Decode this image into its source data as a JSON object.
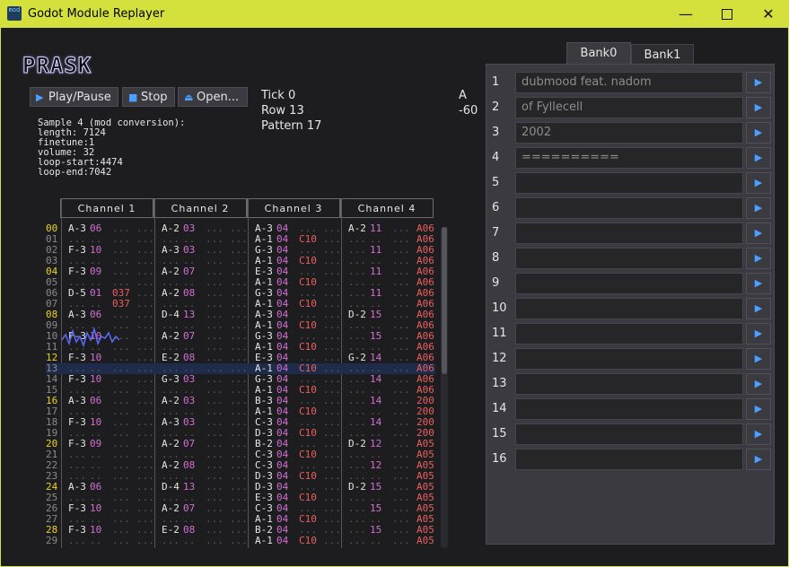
{
  "window": {
    "title": "Godot Module Replayer",
    "icon_label": "mod"
  },
  "logo": "PRASK",
  "buttons": {
    "play": "Play/Pause",
    "stop": "Stop",
    "open": "Open..."
  },
  "status": {
    "tick": "Tick 0",
    "row": "Row 13",
    "pattern": "Pattern 17",
    "right_top": "A",
    "right_bottom": "-60"
  },
  "sample_info": [
    "Sample 4 (mod conversion):",
    "length: 7124",
    "finetune:1",
    "volume: 32",
    "loop-start:4474",
    "loop-end:7042"
  ],
  "channels": [
    "Channel 1",
    "Channel 2",
    "Channel 3",
    "Channel 4"
  ],
  "current_row": 13,
  "rows": [
    {
      "n": "00",
      "c": [
        [
          "A-3",
          "06",
          "",
          ""
        ],
        [
          "A-2",
          "03",
          "",
          ""
        ],
        [
          "A-3",
          "04",
          "",
          ""
        ],
        [
          "A-2",
          "11",
          "",
          "A06"
        ]
      ]
    },
    {
      "n": "01",
      "c": [
        [
          "",
          "",
          "",
          ""
        ],
        [
          "",
          "",
          "",
          ""
        ],
        [
          "A-1",
          "04",
          "C10",
          ""
        ],
        [
          "",
          "",
          "",
          "A06"
        ]
      ]
    },
    {
      "n": "02",
      "c": [
        [
          "F-3",
          "10",
          "",
          ""
        ],
        [
          "A-3",
          "03",
          "",
          ""
        ],
        [
          "G-3",
          "04",
          "",
          ""
        ],
        [
          "",
          "11",
          "",
          "A06"
        ]
      ]
    },
    {
      "n": "03",
      "c": [
        [
          "",
          "",
          "",
          ""
        ],
        [
          "",
          "",
          "",
          ""
        ],
        [
          "A-1",
          "04",
          "C10",
          ""
        ],
        [
          "",
          "",
          "",
          "A06"
        ]
      ]
    },
    {
      "n": "04",
      "c": [
        [
          "F-3",
          "09",
          "",
          ""
        ],
        [
          "A-2",
          "07",
          "",
          ""
        ],
        [
          "E-3",
          "04",
          "",
          ""
        ],
        [
          "",
          "11",
          "",
          "A06"
        ]
      ]
    },
    {
      "n": "05",
      "c": [
        [
          "",
          "",
          "",
          ""
        ],
        [
          "",
          "",
          "",
          ""
        ],
        [
          "A-1",
          "04",
          "C10",
          ""
        ],
        [
          "",
          "",
          "",
          "A06"
        ]
      ]
    },
    {
      "n": "06",
      "c": [
        [
          "D-5",
          "01",
          "037",
          ""
        ],
        [
          "A-2",
          "08",
          "",
          ""
        ],
        [
          "G-3",
          "04",
          "",
          ""
        ],
        [
          "",
          "11",
          "",
          "A06"
        ]
      ]
    },
    {
      "n": "07",
      "c": [
        [
          "",
          "",
          "037",
          ""
        ],
        [
          "",
          "",
          "",
          ""
        ],
        [
          "A-1",
          "04",
          "C10",
          ""
        ],
        [
          "",
          "",
          "",
          "A06"
        ]
      ]
    },
    {
      "n": "08",
      "c": [
        [
          "A-3",
          "06",
          "",
          ""
        ],
        [
          "D-4",
          "13",
          "",
          ""
        ],
        [
          "A-3",
          "04",
          "",
          ""
        ],
        [
          "D-2",
          "15",
          "",
          "A06"
        ]
      ]
    },
    {
      "n": "09",
      "c": [
        [
          "",
          "",
          "",
          ""
        ],
        [
          "",
          "",
          "",
          ""
        ],
        [
          "A-1",
          "04",
          "C10",
          ""
        ],
        [
          "",
          "",
          "",
          "A06"
        ]
      ]
    },
    {
      "n": "10",
      "c": [
        [
          "F-3",
          "10",
          "",
          ""
        ],
        [
          "A-2",
          "07",
          "",
          ""
        ],
        [
          "G-3",
          "04",
          "",
          ""
        ],
        [
          "",
          "15",
          "",
          "A06"
        ]
      ]
    },
    {
      "n": "11",
      "c": [
        [
          "",
          "",
          "",
          ""
        ],
        [
          "",
          "",
          "",
          ""
        ],
        [
          "A-1",
          "04",
          "C10",
          ""
        ],
        [
          "",
          "",
          "",
          "A06"
        ]
      ]
    },
    {
      "n": "12",
      "c": [
        [
          "F-3",
          "10",
          "",
          ""
        ],
        [
          "E-2",
          "08",
          "",
          ""
        ],
        [
          "E-3",
          "04",
          "",
          ""
        ],
        [
          "G-2",
          "14",
          "",
          "A06"
        ]
      ]
    },
    {
      "n": "13",
      "c": [
        [
          "",
          "",
          "",
          ""
        ],
        [
          "",
          "",
          "",
          ""
        ],
        [
          "A-1",
          "04",
          "C10",
          ""
        ],
        [
          "",
          "",
          "",
          "A06"
        ]
      ]
    },
    {
      "n": "14",
      "c": [
        [
          "F-3",
          "10",
          "",
          ""
        ],
        [
          "G-3",
          "03",
          "",
          ""
        ],
        [
          "G-3",
          "04",
          "",
          ""
        ],
        [
          "",
          "14",
          "",
          "A06"
        ]
      ]
    },
    {
      "n": "15",
      "c": [
        [
          "",
          "",
          "",
          ""
        ],
        [
          "",
          "",
          "",
          ""
        ],
        [
          "A-1",
          "04",
          "C10",
          ""
        ],
        [
          "",
          "",
          "",
          "A06"
        ]
      ]
    },
    {
      "n": "16",
      "c": [
        [
          "A-3",
          "06",
          "",
          ""
        ],
        [
          "A-2",
          "03",
          "",
          ""
        ],
        [
          "B-3",
          "04",
          "",
          ""
        ],
        [
          "",
          "14",
          "",
          "200"
        ]
      ]
    },
    {
      "n": "17",
      "c": [
        [
          "",
          "",
          "",
          ""
        ],
        [
          "",
          "",
          "",
          ""
        ],
        [
          "A-1",
          "04",
          "C10",
          ""
        ],
        [
          "",
          "",
          "",
          "200"
        ]
      ]
    },
    {
      "n": "18",
      "c": [
        [
          "F-3",
          "10",
          "",
          ""
        ],
        [
          "A-3",
          "03",
          "",
          ""
        ],
        [
          "C-3",
          "04",
          "",
          ""
        ],
        [
          "",
          "14",
          "",
          "200"
        ]
      ]
    },
    {
      "n": "19",
      "c": [
        [
          "",
          "",
          "",
          ""
        ],
        [
          "",
          "",
          "",
          ""
        ],
        [
          "D-3",
          "04",
          "C10",
          ""
        ],
        [
          "",
          "",
          "",
          "200"
        ]
      ]
    },
    {
      "n": "20",
      "c": [
        [
          "F-3",
          "09",
          "",
          ""
        ],
        [
          "A-2",
          "07",
          "",
          ""
        ],
        [
          "B-2",
          "04",
          "",
          ""
        ],
        [
          "D-2",
          "12",
          "",
          "A05"
        ]
      ]
    },
    {
      "n": "21",
      "c": [
        [
          "",
          "",
          "",
          ""
        ],
        [
          "",
          "",
          "",
          ""
        ],
        [
          "C-3",
          "04",
          "C10",
          ""
        ],
        [
          "",
          "",
          "",
          "A05"
        ]
      ]
    },
    {
      "n": "22",
      "c": [
        [
          "",
          "",
          "",
          ""
        ],
        [
          "A-2",
          "08",
          "",
          ""
        ],
        [
          "C-3",
          "04",
          "",
          ""
        ],
        [
          "",
          "12",
          "",
          "A05"
        ]
      ]
    },
    {
      "n": "23",
      "c": [
        [
          "",
          "",
          "",
          ""
        ],
        [
          "",
          "",
          "",
          ""
        ],
        [
          "D-3",
          "04",
          "C10",
          ""
        ],
        [
          "",
          "",
          "",
          "A05"
        ]
      ]
    },
    {
      "n": "24",
      "c": [
        [
          "A-3",
          "06",
          "",
          ""
        ],
        [
          "D-4",
          "13",
          "",
          ""
        ],
        [
          "D-3",
          "04",
          "",
          ""
        ],
        [
          "D-2",
          "15",
          "",
          "A05"
        ]
      ]
    },
    {
      "n": "25",
      "c": [
        [
          "",
          "",
          "",
          ""
        ],
        [
          "",
          "",
          "",
          ""
        ],
        [
          "E-3",
          "04",
          "C10",
          ""
        ],
        [
          "",
          "",
          "",
          "A05"
        ]
      ]
    },
    {
      "n": "26",
      "c": [
        [
          "F-3",
          "10",
          "",
          ""
        ],
        [
          "A-2",
          "07",
          "",
          ""
        ],
        [
          "C-3",
          "04",
          "",
          ""
        ],
        [
          "",
          "15",
          "",
          "A05"
        ]
      ]
    },
    {
      "n": "27",
      "c": [
        [
          "",
          "",
          "",
          ""
        ],
        [
          "",
          "",
          "",
          ""
        ],
        [
          "A-1",
          "04",
          "C10",
          ""
        ],
        [
          "",
          "",
          "",
          "A05"
        ]
      ]
    },
    {
      "n": "28",
      "c": [
        [
          "F-3",
          "10",
          "",
          ""
        ],
        [
          "E-2",
          "08",
          "",
          ""
        ],
        [
          "B-2",
          "04",
          "",
          ""
        ],
        [
          "",
          "15",
          "",
          "A05"
        ]
      ]
    },
    {
      "n": "29",
      "c": [
        [
          "",
          "",
          "",
          ""
        ],
        [
          "",
          "",
          "",
          ""
        ],
        [
          "A-1",
          "04",
          "C10",
          ""
        ],
        [
          "",
          "",
          "",
          "A05"
        ]
      ]
    }
  ],
  "bank_tabs": [
    "Bank0",
    "Bank1"
  ],
  "bank_rows": [
    {
      "num": "1",
      "text": "dubmood feat. nadom"
    },
    {
      "num": "2",
      "text": "of Fyllecell"
    },
    {
      "num": "3",
      "text": "2002"
    },
    {
      "num": "4",
      "text": "=========="
    },
    {
      "num": "5",
      "text": ""
    },
    {
      "num": "6",
      "text": ""
    },
    {
      "num": "7",
      "text": ""
    },
    {
      "num": "8",
      "text": ""
    },
    {
      "num": "9",
      "text": ""
    },
    {
      "num": "10",
      "text": ""
    },
    {
      "num": "11",
      "text": ""
    },
    {
      "num": "12",
      "text": ""
    },
    {
      "num": "13",
      "text": ""
    },
    {
      "num": "14",
      "text": ""
    },
    {
      "num": "15",
      "text": ""
    },
    {
      "num": "16",
      "text": ""
    }
  ],
  "colors": {
    "accent": "#4aa0ff",
    "row_highlight": "#e8d22a",
    "instrument": "#d070d0",
    "effect": "#e86060"
  }
}
